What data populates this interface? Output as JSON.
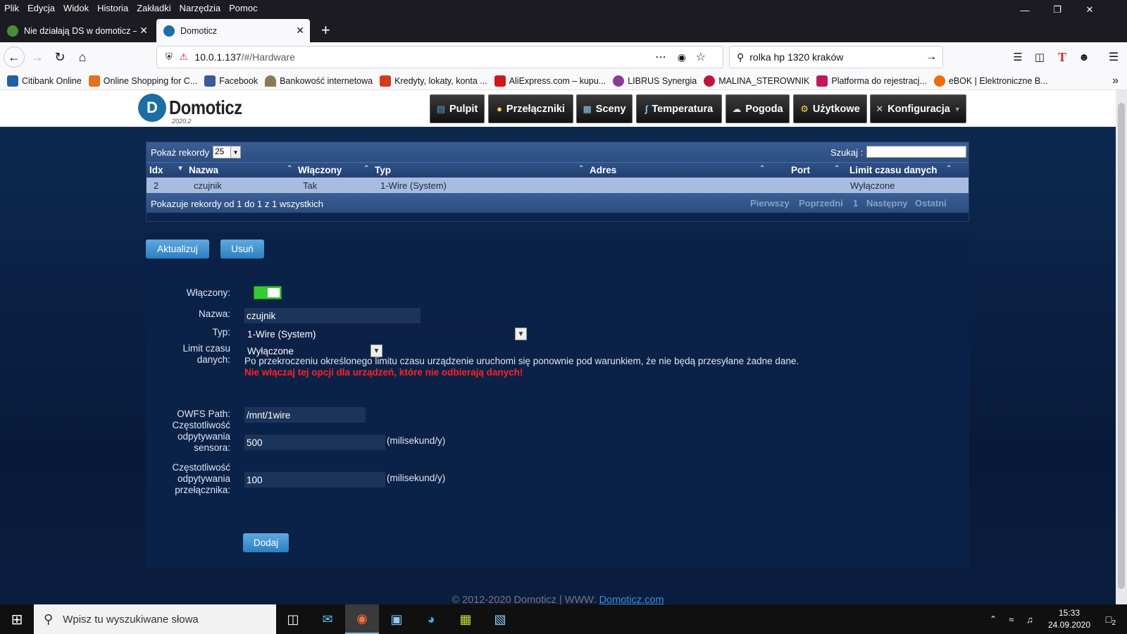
{
  "firefox": {
    "menu": [
      "Plik",
      "Edycja",
      "Widok",
      "Historia",
      "Zakładki",
      "Narzędzia",
      "Pomoc"
    ],
    "tabs": [
      {
        "title": "Nie działają DS w domoticz – D",
        "active": false
      },
      {
        "title": "Domoticz",
        "active": true
      }
    ],
    "url_host": "10.0.1.137",
    "url_path": "/#/Hardware",
    "search_value": "rolka hp 1320 kraków",
    "bookmarks": [
      {
        "label": "Citibank Online",
        "color": "#1f5fa8"
      },
      {
        "label": "Online Shopping for C...",
        "color": "#e56f1e"
      },
      {
        "label": "Facebook",
        "color": "#3b5998"
      },
      {
        "label": "Bankowość internetowa",
        "color": "#8a7a55"
      },
      {
        "label": "Kredyty, lokaty, konta ...",
        "color": "#d23b1d"
      },
      {
        "label": "AliExpress.com – kupu...",
        "color": "#d0171d"
      },
      {
        "label": "LIBRUS Synergia",
        "color": "#8a3d8f"
      },
      {
        "label": "MALINA_STEROWNIK",
        "color": "#c0143c"
      },
      {
        "label": "Platforma do rejestracj...",
        "color": "#c2185b"
      },
      {
        "label": "eBOK | Elektroniczne B...",
        "color": "#ef6c00"
      }
    ]
  },
  "domoticz": {
    "logo": "Domoticz",
    "version": "2020.2",
    "nav": [
      {
        "label": "Pulpit",
        "icon": "dashboard-icon"
      },
      {
        "label": "Przełączniki",
        "icon": "lightbulb-icon"
      },
      {
        "label": "Sceny",
        "icon": "scene-icon"
      },
      {
        "label": "Temperatura",
        "icon": "thermometer-icon"
      },
      {
        "label": "Pogoda",
        "icon": "weather-icon"
      },
      {
        "label": "Użytkowe",
        "icon": "utility-icon"
      },
      {
        "label": "Konfiguracja",
        "icon": "tools-icon"
      }
    ],
    "table": {
      "show_label": "Pokaż rekordy",
      "page_size": "25",
      "search_label": "Szukaj :",
      "columns": [
        "Idx",
        "Nazwa",
        "Włączony",
        "Typ",
        "Adres",
        "Port",
        "Limit czasu danych"
      ],
      "rows": [
        {
          "idx": "2",
          "name": "czujnik",
          "enabled": "Tak",
          "type": "1-Wire (System)",
          "address": "",
          "port": "",
          "timeout": "Wyłączone"
        }
      ],
      "info": "Pokazuje rekordy od 1 do 1 z 1 wszystkich",
      "pagination": [
        "Pierwszy",
        "Poprzedni",
        "1",
        "Następny",
        "Ostatni"
      ]
    },
    "buttons": {
      "update": "Aktualizuj",
      "delete": "Usuń",
      "add": "Dodaj"
    },
    "form": {
      "enabled_label": "Włączony:",
      "enabled": true,
      "name_label": "Nazwa:",
      "name_value": "czujnik",
      "type_label": "Typ:",
      "type_value": "1-Wire (System)",
      "timeout_label_1": "Limit czasu",
      "timeout_label_2": "danych:",
      "timeout_value": "Wyłączone",
      "timeout_help": "Po przekroczeniu określonego limitu czasu urządzenie uruchomi się ponownie pod warunkiem, że nie będą przesyłane żadne dane.",
      "timeout_warning": "Nie włączaj tej opcji dla urządzeń, które nie odbierają danych!",
      "owfs_label": "OWFS Path:",
      "owfs_value": "/mnt/1wire",
      "sensor_poll_label_1": "Częstotliwość",
      "sensor_poll_label_2": "odpytywania",
      "sensor_poll_label_3": "sensora:",
      "sensor_poll_value": "500",
      "switch_poll_label_1": "Częstotliwość",
      "switch_poll_label_2": "odpytywania",
      "switch_poll_label_3": "przełącznika:",
      "switch_poll_value": "100",
      "unit": "(milisekund/y)"
    },
    "footer_text": "© 2012-2020 Domoticz | WWW: ",
    "footer_link": "Domoticz.com"
  },
  "taskbar": {
    "search_placeholder": "Wpisz tu wyszukiwane słowa",
    "time": "15:33",
    "date": "24.09.2020",
    "notifications": "2"
  }
}
